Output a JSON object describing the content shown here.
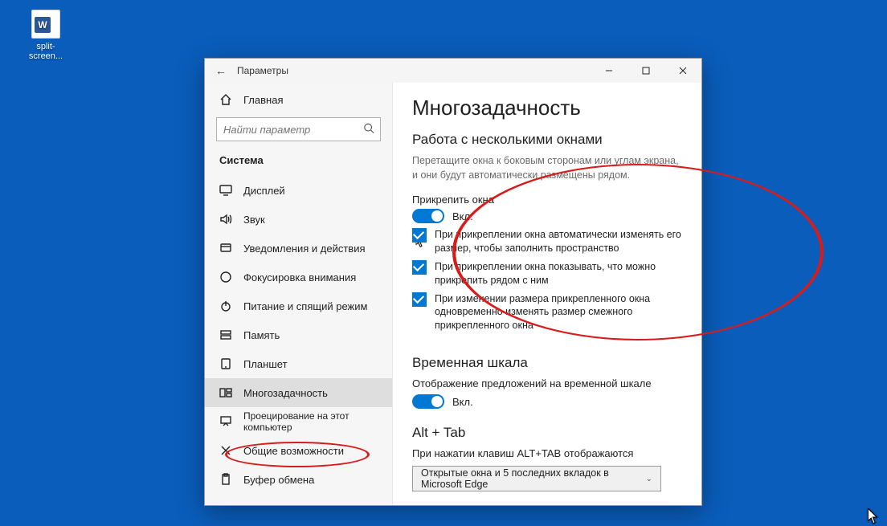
{
  "desktop": {
    "icon_label": "split-screen..."
  },
  "titlebar": {
    "title": "Параметры"
  },
  "sidebar": {
    "home": "Главная",
    "search_placeholder": "Найти параметр",
    "section": "Система",
    "items": [
      {
        "label": "Дисплей"
      },
      {
        "label": "Звук"
      },
      {
        "label": "Уведомления и действия"
      },
      {
        "label": "Фокусировка внимания"
      },
      {
        "label": "Питание и спящий режим"
      },
      {
        "label": "Память"
      },
      {
        "label": "Планшет"
      },
      {
        "label": "Многозадачность"
      },
      {
        "label": "Проецирование на этот компьютер"
      },
      {
        "label": "Общие возможности"
      },
      {
        "label": "Буфер обмена"
      }
    ]
  },
  "content": {
    "heading": "Многозадачность",
    "section1": {
      "title": "Работа с несколькими окнами",
      "desc": "Перетащите окна к боковым сторонам или углам экрана, и они будут автоматически размещены рядом.",
      "snap_label": "Прикрепить окна",
      "snap_state": "Вкл.",
      "chk1": "При прикреплении окна автоматически изменять его размер, чтобы заполнить пространство",
      "chk2": "При прикреплении окна показывать, что можно прикрепить рядом с ним",
      "chk3": "При изменении размера прикрепленного окна одновременно изменять размер смежного прикрепленного окна"
    },
    "section2": {
      "title": "Временная шкала",
      "desc": "Отображение предложений на временной шкале",
      "state": "Вкл."
    },
    "section3": {
      "title": "Alt + Tab",
      "desc": "При нажатии клавиш ALT+TAB отображаются",
      "dropdown": "Открытые окна и 5 последних вкладок в Microsoft Edge"
    }
  }
}
